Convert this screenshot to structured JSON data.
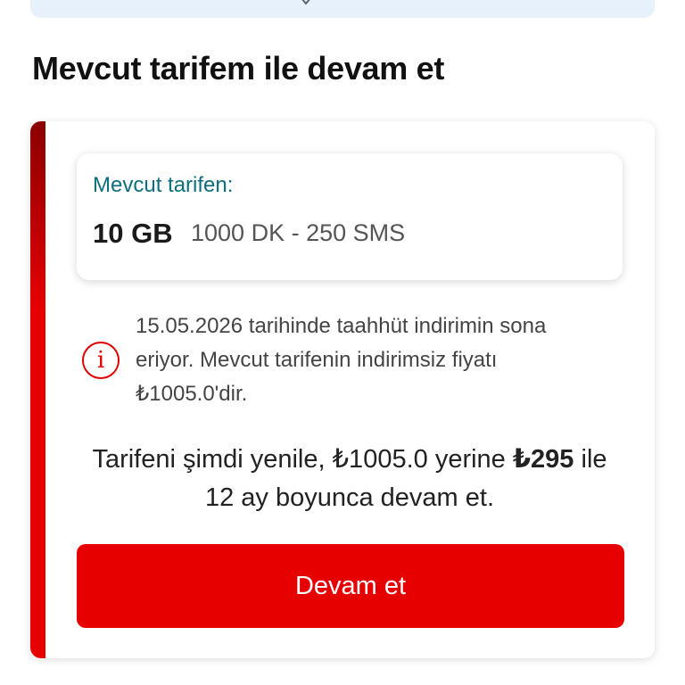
{
  "top_banner": {
    "icon": "chevron-down-icon"
  },
  "section": {
    "title": "Mevcut tarifem ile devam et"
  },
  "current_plan": {
    "label": "Mevcut tarifen:",
    "data": "10 GB",
    "details": "1000 DK - 250 SMS"
  },
  "notice": {
    "icon": "info-icon",
    "text": "15.05.2026 tarihinde taahhüt indirimin sona eriyor. Mevcut tarifenin indirimsiz fiyatı ₺1005.0'dir."
  },
  "offer": {
    "prefix": "Tarifeni şimdi yenile, ",
    "old_price": "₺1005.0",
    "middle": " yerine ",
    "new_price": "₺295",
    "suffix": " ile 12 ay boyunca devam et."
  },
  "cta": {
    "label": "Devam et"
  },
  "colors": {
    "accent": "#e60000",
    "accent_dark": "#8a0000",
    "label_teal": "#0d6f7d",
    "banner_bg": "#e6f1fb"
  }
}
